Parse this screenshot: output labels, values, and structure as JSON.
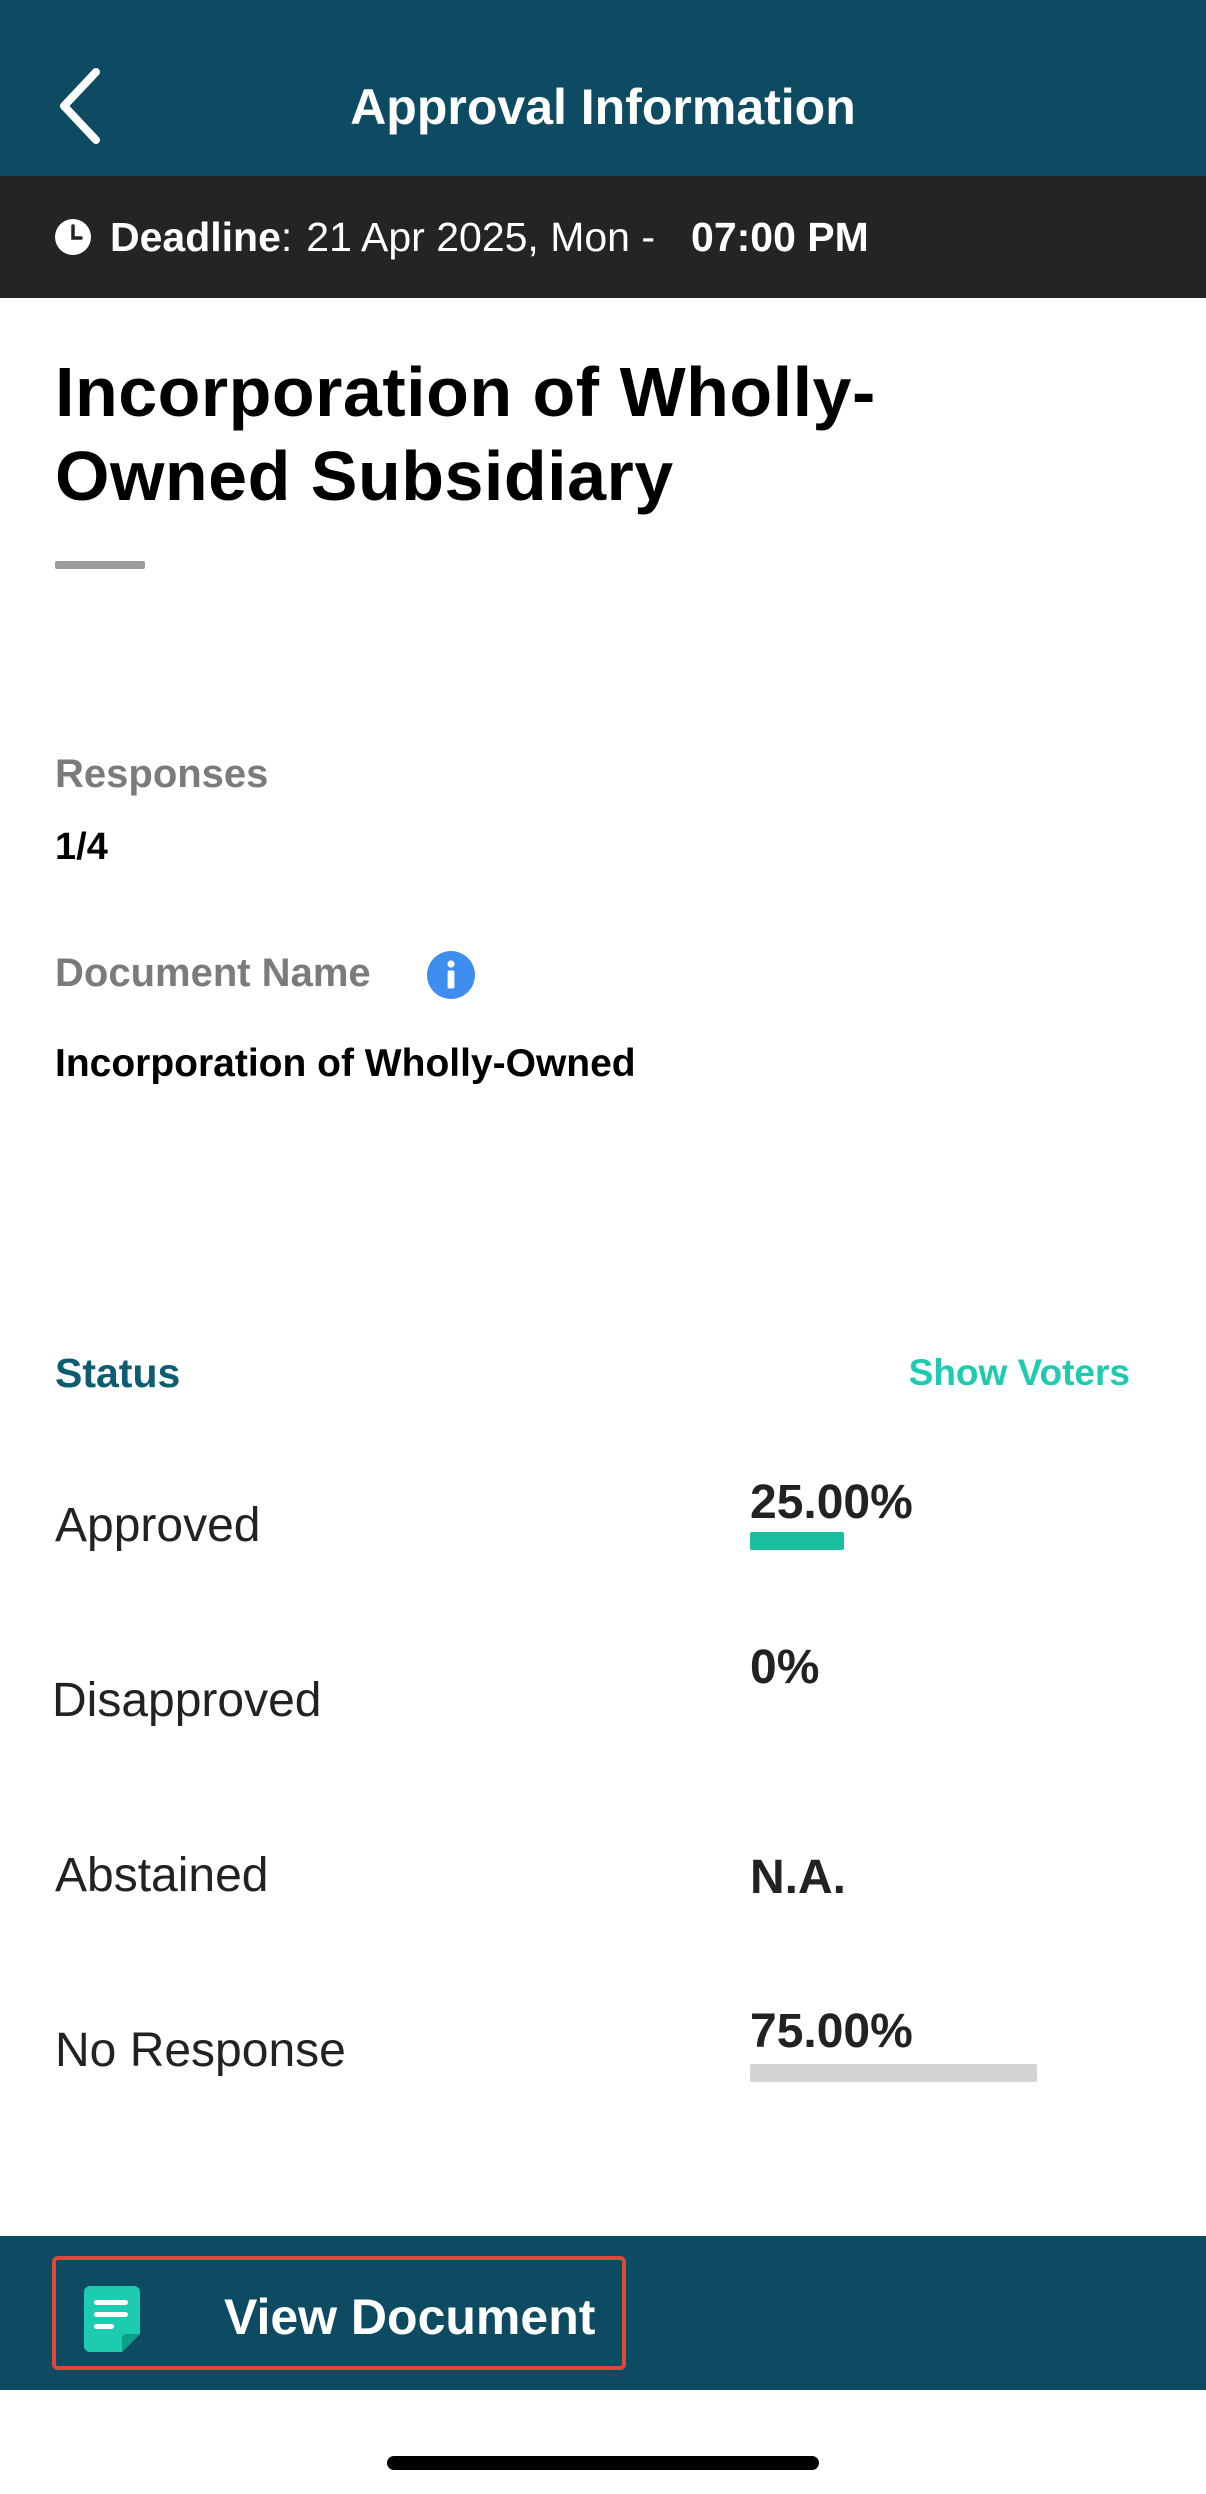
{
  "header": {
    "title": "Approval Information"
  },
  "deadline": {
    "label": "Deadline",
    "colon": ":",
    "date": "21 Apr 2025, Mon -",
    "time": "07:00 PM"
  },
  "document": {
    "title_line1": "Incorporation of Wholly-",
    "title_line2": "Owned Subsidiary",
    "responses_label": "Responses",
    "responses_value": "1/4",
    "name_label": "Document Name",
    "name_value": "Incorporation of Wholly-Owned"
  },
  "status": {
    "heading": "Status",
    "show_voters": "Show Voters",
    "rows": [
      {
        "label": "Approved",
        "value": "25.00%",
        "fraction": 0.25,
        "color": "#1abf9f"
      },
      {
        "label": "Disapproved",
        "value": "0%",
        "fraction": 0,
        "color": "#1abf9f"
      },
      {
        "label": "Abstained",
        "value": "N.A.",
        "fraction": null,
        "color": "#1abf9f"
      },
      {
        "label": "No Response",
        "value": "75.00%",
        "fraction": 0.75,
        "color": "#d4d4d4"
      }
    ]
  },
  "footer": {
    "view_document": "View Document"
  },
  "colors": {
    "header_bg": "#0c4b61",
    "deadline_bg": "#242424",
    "accent_teal": "#1ccbb0",
    "status_heading": "#0c5c72",
    "info_blue": "#3e8ef0",
    "highlight_border": "#e2483a"
  },
  "icons": {
    "back": "chevron-left-icon",
    "clock": "clock-icon",
    "info": "info-icon",
    "document": "document-icon"
  }
}
